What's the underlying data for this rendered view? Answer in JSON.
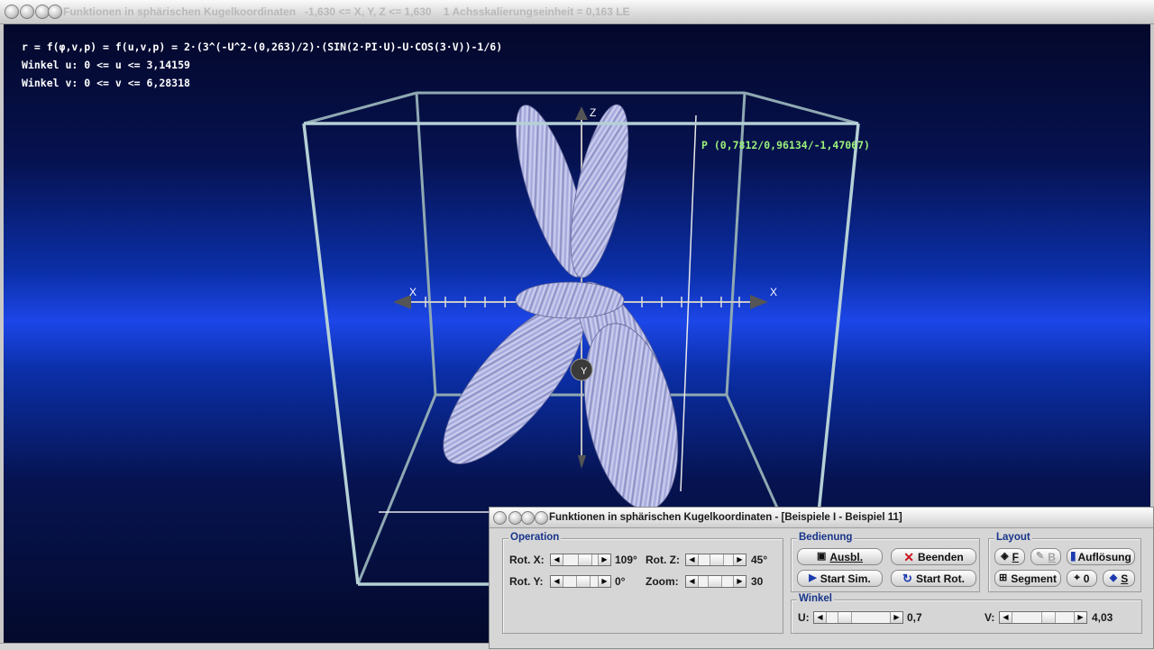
{
  "main_window": {
    "title": "Funktionen in sphärischen Kugelkoordinaten   -1,630 <= X, Y, Z <= 1,630    1 Achsskalierungseinheit = 0,163 LE"
  },
  "viewport": {
    "formula": "r = f(φ,v,p) = f(u,v,p) = 2·(3^(-U^2-(0,263)/2)·(SIN(2·PI·U)-U·COS(3·V))-1/6)",
    "range_u": "Winkel u: 0 <= u <= 3,14159",
    "range_v": "Winkel v: 0 <= v <= 6,28318",
    "point_label": "P (0,7812/0,96134/-1,47067)",
    "axis_labels": {
      "z": "Z",
      "x_neg": "X",
      "x_pos": "X",
      "y": "Y"
    }
  },
  "control_window": {
    "title": "Funktionen in sphärischen Kugelkoordinaten - [Beispiele I - Beispiel 11]",
    "operation": {
      "legend": "Operation",
      "rot_x": {
        "label": "Rot. X:",
        "value": "109°",
        "level": 0.3
      },
      "rot_y": {
        "label": "Rot. Y:",
        "value": "0°",
        "level": 0.5
      },
      "rot_z": {
        "label": "Rot. Z:",
        "value": "45°",
        "level": 0.45
      },
      "zoom": {
        "label": "Zoom:",
        "value": "30",
        "level": 0.42
      }
    },
    "bedienung": {
      "legend": "Bedienung",
      "ausbl": "Ausbl.",
      "beenden": "Beenden",
      "start_sim": "Start Sim.",
      "start_rot": "Start Rot."
    },
    "layout": {
      "legend": "Layout",
      "f": "F",
      "b": "B",
      "aufloesung": "Auflösung",
      "segment": "Segment",
      "zero": "0",
      "s": "S"
    },
    "winkel": {
      "legend": "Winkel",
      "u": {
        "label": "U:",
        "value": "0,7",
        "level": 0.22
      },
      "v": {
        "label": "V:",
        "value": "4,03",
        "level": 0.64
      }
    }
  },
  "colors": {
    "accent": "#17348a",
    "surface": "#b9bce8",
    "box": "#b5d0d6",
    "point_label": "#9cf27a"
  }
}
